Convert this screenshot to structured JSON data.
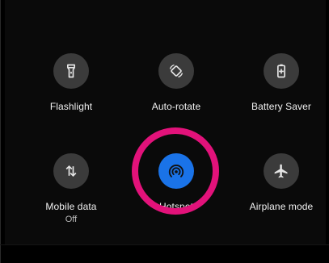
{
  "quick_settings": {
    "tiles": [
      {
        "label": "Flashlight",
        "sublabel": "",
        "icon": "flashlight-icon",
        "active": false
      },
      {
        "label": "Auto-rotate",
        "sublabel": "",
        "icon": "auto-rotate-icon",
        "active": false
      },
      {
        "label": "Battery Saver",
        "sublabel": "",
        "icon": "battery-saver-icon",
        "active": false
      },
      {
        "label": "Mobile data",
        "sublabel": "Off",
        "icon": "mobile-data-icon",
        "active": false
      },
      {
        "label": "Hotspot",
        "sublabel": "",
        "icon": "hotspot-icon",
        "active": true
      },
      {
        "label": "Airplane mode",
        "sublabel": "",
        "icon": "airplane-mode-icon",
        "active": false
      }
    ]
  },
  "colors": {
    "background": "#000000",
    "tile_inactive": "#3b3b3b",
    "tile_active": "#1a73e8",
    "highlight_ring": "#e2127a",
    "label_text": "#f1f1f1"
  }
}
